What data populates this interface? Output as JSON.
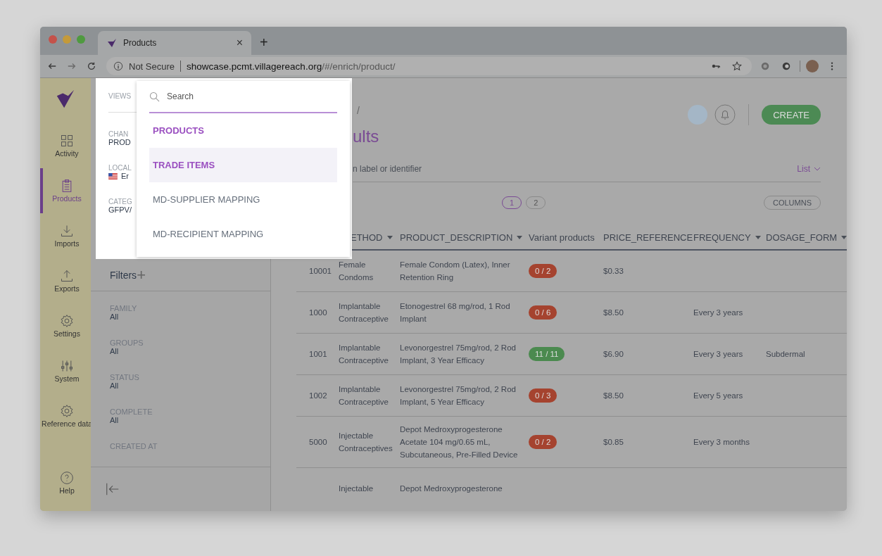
{
  "browser": {
    "tab": {
      "title": "Products",
      "close": "×"
    },
    "new_tab": "+",
    "security": "Not Secure",
    "url": {
      "host": "showcase.pcmt.villagereach.org",
      "path": "/#/enrich/product/"
    }
  },
  "nav": [
    {
      "label": "Activity",
      "selected": false
    },
    {
      "label": "Products",
      "selected": true
    },
    {
      "label": "Imports",
      "selected": false
    },
    {
      "label": "Exports",
      "selected": false
    },
    {
      "label": "Settings",
      "selected": false
    },
    {
      "label": "System",
      "selected": false
    },
    {
      "label": "Reference data",
      "selected": false
    }
  ],
  "help": {
    "label": "Help"
  },
  "views_panel": {
    "sections": [
      {
        "label": "VIEWS"
      },
      {
        "label": "CHAN",
        "value": "PROD"
      },
      {
        "label": "LOCAL",
        "value": "Er",
        "flag": true
      },
      {
        "label": "CATEG",
        "value": "GFPV/"
      }
    ]
  },
  "views_dropdown": {
    "search": {
      "placeholder": "Search"
    },
    "items": [
      {
        "label": "PRODUCTS",
        "selected": true,
        "highlighted": false
      },
      {
        "label": "TRADE ITEMS",
        "selected": true,
        "highlighted": true
      },
      {
        "label": "MD-SUPPLIER MAPPING",
        "selected": false,
        "highlighted": false
      },
      {
        "label": "MD-RECIPIENT MAPPING",
        "selected": false,
        "highlighted": false
      }
    ]
  },
  "filters": {
    "title": "Filters",
    "add": "+",
    "items": [
      {
        "label": "FAMILY",
        "value": "All"
      },
      {
        "label": "GROUPS",
        "value": "All"
      },
      {
        "label": "STATUS",
        "value": "All"
      },
      {
        "label": "COMPLETE",
        "value": "All"
      },
      {
        "label": "CREATED AT"
      }
    ]
  },
  "header": {
    "breadcrumb": "/",
    "title": "ults",
    "search_text": "n label or identifier",
    "view_mode": "List",
    "create": "CREATE"
  },
  "pagination": [
    {
      "label": "1",
      "selected": true
    },
    {
      "label": "2",
      "selected": false
    }
  ],
  "columns_button": "COLUMNS",
  "table": {
    "columns": [
      "ETHOD",
      "PRODUCT_DESCRIPTION",
      "Variant products",
      "PRICE_REFERENCE",
      "FREQUENCY",
      "DOSAGE_FORM"
    ],
    "sortable": [
      true,
      true,
      false,
      false,
      true,
      true
    ],
    "rows": [
      {
        "id": "10001",
        "type": "Female Condoms",
        "description": "Female Condom (Latex), Inner Retention Ring",
        "variants": "0 / 2",
        "color": "#a5432f",
        "price": "$0.33"
      },
      {
        "id": "1000",
        "type": "Implantable Contraceptive",
        "description": "Etonogestrel 68 mg/rod, 1 Rod Implant",
        "variants": "0 / 6",
        "color": "#a5432f",
        "price": "$8.50",
        "frequency": "Every 3 years"
      },
      {
        "id": "1001",
        "type": "Implantable Contraceptive",
        "description": "Levonorgestrel 75mg/rod, 2 Rod Implant, 3 Year Efficacy",
        "variants": "11 / 11",
        "color": "#4b8a4f",
        "price": "$6.90",
        "frequency": "Every 3 years",
        "dosage": "Subdermal"
      },
      {
        "id": "1002",
        "type": "Implantable Contraceptive",
        "description": "Levonorgestrel 75mg/rod, 2 Rod Implant, 5 Year Efficacy",
        "variants": "0 / 3",
        "color": "#a5432f",
        "price": "$8.50",
        "frequency": "Every 5 years"
      },
      {
        "id": "5000",
        "type": "Injectable Contraceptives",
        "description": "Depot Medroxyprogesterone Acetate 104 mg/0.65 mL, Subcutaneous, Pre-Filled Device",
        "variants": "0 / 2",
        "color": "#a5432f",
        "price": "$0.85",
        "frequency": "Every 3 months"
      },
      {
        "type": "Injectable",
        "description": "Depot Medroxyprogesterone"
      }
    ]
  }
}
